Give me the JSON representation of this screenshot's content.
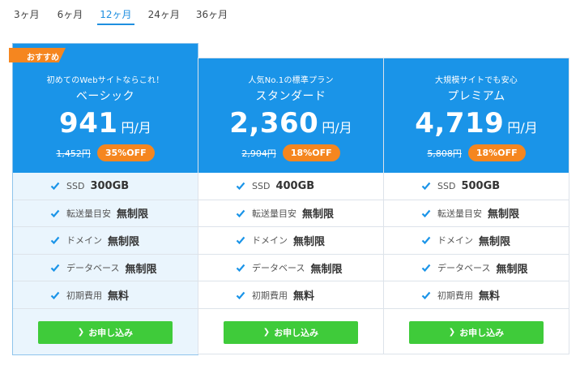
{
  "tabs": [
    {
      "label": "3ヶ月",
      "active": false
    },
    {
      "label": "6ヶ月",
      "active": false
    },
    {
      "label": "12ヶ月",
      "active": true
    },
    {
      "label": "24ヶ月",
      "active": false
    },
    {
      "label": "36ヶ月",
      "active": false
    }
  ],
  "colors": {
    "accent": "#1a94e8",
    "orange": "#f5861f",
    "green": "#3fcb3a"
  },
  "plans": [
    {
      "badge": "おすすめ",
      "tagline": "初めてのWebサイトならこれ！",
      "name": "ベーシック",
      "price": "941",
      "unit": "円/月",
      "original": "1,452円",
      "discount": "35%OFF",
      "features": [
        {
          "label": "SSD",
          "value": "300GB"
        },
        {
          "label": "転送量目安",
          "value": "無制限"
        },
        {
          "label": "ドメイン",
          "value": "無制限"
        },
        {
          "label": "データベース",
          "value": "無制限"
        },
        {
          "label": "初期費用",
          "value": "無料"
        }
      ],
      "button": "お申し込み"
    },
    {
      "tagline": "人気No.1の標準プラン",
      "name": "スタンダード",
      "price": "2,360",
      "unit": "円/月",
      "original": "2,904円",
      "discount": "18%OFF",
      "features": [
        {
          "label": "SSD",
          "value": "400GB"
        },
        {
          "label": "転送量目安",
          "value": "無制限"
        },
        {
          "label": "ドメイン",
          "value": "無制限"
        },
        {
          "label": "データベース",
          "value": "無制限"
        },
        {
          "label": "初期費用",
          "value": "無料"
        }
      ],
      "button": "お申し込み"
    },
    {
      "tagline": "大規模サイトでも安心",
      "name": "プレミアム",
      "price": "4,719",
      "unit": "円/月",
      "original": "5,808円",
      "discount": "18%OFF",
      "features": [
        {
          "label": "SSD",
          "value": "500GB"
        },
        {
          "label": "転送量目安",
          "value": "無制限"
        },
        {
          "label": "ドメイン",
          "value": "無制限"
        },
        {
          "label": "データベース",
          "value": "無制限"
        },
        {
          "label": "初期費用",
          "value": "無料"
        }
      ],
      "button": "お申し込み"
    }
  ]
}
